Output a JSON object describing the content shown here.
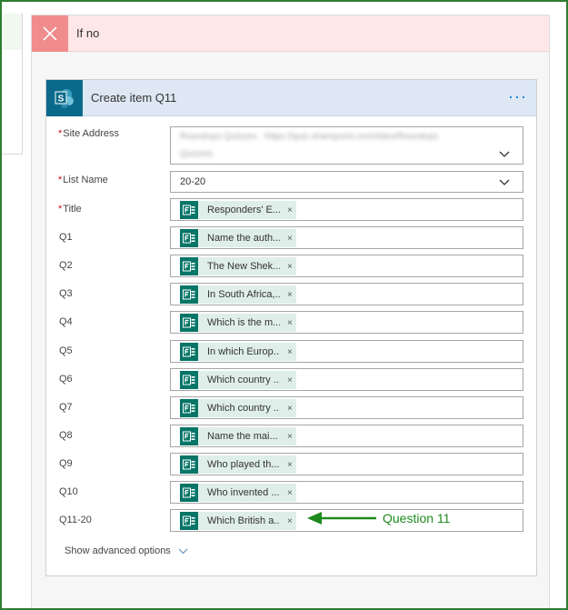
{
  "condition": {
    "title": "If no"
  },
  "action": {
    "title": "Create item Q11",
    "more_label": "···",
    "site_address": {
      "label": "Site Address",
      "required_mark": "*",
      "value_line1": "Roundups Quizzes · https://quiz.sharepoint.com/sites/Roundups",
      "value_line2": "Quizzes"
    },
    "list_name": {
      "label": "List Name",
      "required_mark": "*",
      "value": "20-20"
    },
    "fields": [
      {
        "label": "Title",
        "required_mark": "*",
        "token": "Responders' E...",
        "remove": "×"
      },
      {
        "label": "Q1",
        "required_mark": "",
        "token": "Name the auth...",
        "remove": "×"
      },
      {
        "label": "Q2",
        "required_mark": "",
        "token": "The New Shek...",
        "remove": "×"
      },
      {
        "label": "Q3",
        "required_mark": "",
        "token": "In South Africa,...",
        "remove": "×"
      },
      {
        "label": "Q4",
        "required_mark": "",
        "token": "Which is the m...",
        "remove": "×"
      },
      {
        "label": "Q5",
        "required_mark": "",
        "token": "In which Europ...",
        "remove": "×"
      },
      {
        "label": "Q6",
        "required_mark": "",
        "token": "Which country ...",
        "remove": "×"
      },
      {
        "label": "Q7",
        "required_mark": "",
        "token": "Which country ...",
        "remove": "×"
      },
      {
        "label": "Q8",
        "required_mark": "",
        "token": "Name the mai...",
        "remove": "×"
      },
      {
        "label": "Q9",
        "required_mark": "",
        "token": "Who played th...",
        "remove": "×"
      },
      {
        "label": "Q10",
        "required_mark": "",
        "token": "Who invented ...",
        "remove": "×"
      },
      {
        "label": "Q11-20",
        "required_mark": "",
        "token": "Which British a...",
        "remove": "×"
      }
    ],
    "advanced_options": "Show advanced options"
  },
  "annotation": {
    "text": "Question 11",
    "color": "#1e8a1e"
  },
  "icons": {
    "condition": "close-x-icon",
    "connector": "sharepoint-icon",
    "token": "microsoft-forms-icon",
    "dropdown": "chevron-down-icon"
  },
  "colors": {
    "frame": "#2e7d32",
    "no_branch_header": "#fde7e7",
    "no_branch_icon": "#f08c8c",
    "action_header": "#dde8f4",
    "sharepoint": "#0b6a8b",
    "forms": "#077568",
    "token_bg": "#dfeee8",
    "more_accent": "#0078d4"
  }
}
